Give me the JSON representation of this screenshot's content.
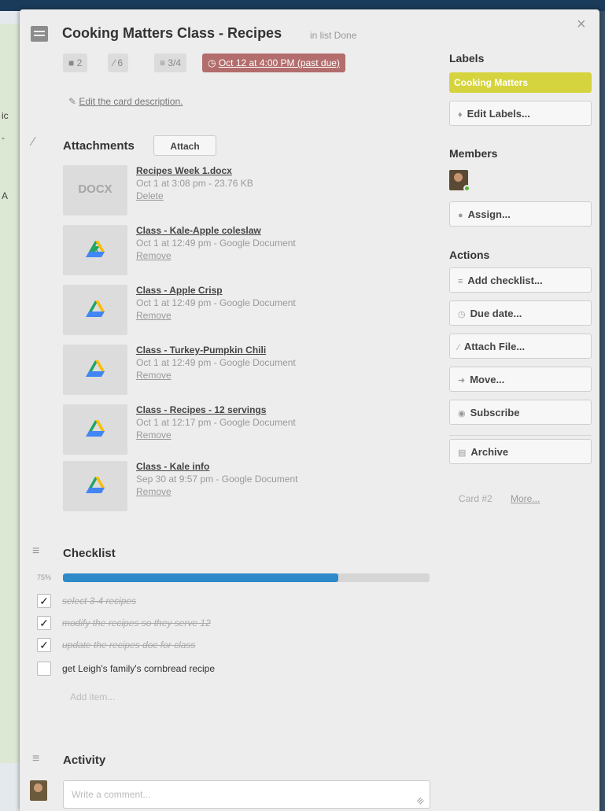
{
  "background": {
    "fragments": [
      "ic",
      "-",
      "A"
    ]
  },
  "card": {
    "title": "Cooking Matters Class - Recipes",
    "in_list": "in list Done",
    "close_glyph": "×",
    "badges": {
      "comments": "2",
      "attachments": "6",
      "checklist": "3/4",
      "due": "Oct 12 at 4:00 PM (past due)"
    },
    "edit_description": "Edit the card description."
  },
  "attachments": {
    "title": "Attachments",
    "attach_button": "Attach",
    "items": [
      {
        "name": "Recipes Week 1.docx",
        "meta": "Oct 1 at 3:08 pm - 23.76 KB",
        "action": "Delete",
        "thumb": "DOCX"
      },
      {
        "name": "Class - Kale-Apple coleslaw",
        "meta": "Oct 1 at 12:49 pm - Google Document",
        "action": "Remove",
        "thumb": "google-drive-icon"
      },
      {
        "name": "Class - Apple Crisp",
        "meta": "Oct 1 at 12:49 pm - Google Document",
        "action": "Remove",
        "thumb": "google-drive-icon"
      },
      {
        "name": "Class - Turkey-Pumpkin Chili",
        "meta": "Oct 1 at 12:49 pm - Google Document",
        "action": "Remove",
        "thumb": "google-drive-icon"
      },
      {
        "name": "Class - Recipes - 12 servings",
        "meta": "Oct 1 at 12:17 pm - Google Document",
        "action": "Remove",
        "thumb": "google-drive-icon"
      },
      {
        "name": "Class - Kale info",
        "meta": "Sep 30 at 9:57 pm - Google Document",
        "action": "Remove",
        "thumb": "google-drive-icon"
      }
    ]
  },
  "checklist": {
    "title": "Checklist",
    "progress_label": "75%",
    "progress": 0.75,
    "items": [
      {
        "text": "select 3-4 recipes",
        "checked": true
      },
      {
        "text": "modify the recipes so they serve 12",
        "checked": true
      },
      {
        "text": "update the recipes doc for class",
        "checked": true
      },
      {
        "text": "get Leigh's family's cornbread recipe",
        "checked": false
      }
    ],
    "add_item": "Add item..."
  },
  "activity": {
    "title": "Activity",
    "comment_placeholder": "Write a comment..."
  },
  "sidebar": {
    "labels_heading": "Labels",
    "label_name": "Cooking Matters",
    "label_color": "#d6d43e",
    "edit_labels": "Edit Labels...",
    "members_heading": "Members",
    "assign": "Assign...",
    "actions_heading": "Actions",
    "actions": {
      "add_checklist": "Add checklist...",
      "due_date": "Due date...",
      "attach_file": "Attach File...",
      "move": "Move...",
      "subscribe": "Subscribe",
      "archive": "Archive"
    },
    "card_number": "Card #2",
    "more": "More..."
  },
  "colors": {
    "due_badge": "#b36d6d",
    "progress_fill": "#2e8ac9",
    "card_bg": "#ededed"
  }
}
